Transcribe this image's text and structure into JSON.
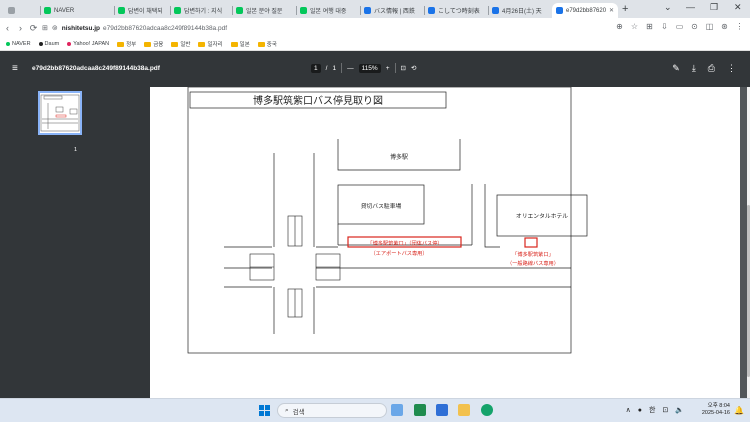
{
  "browser": {
    "tabs": [
      {
        "label": "",
        "color": "#9aa0a6"
      },
      {
        "label": "NAVER",
        "color": "#03c75a"
      },
      {
        "label": "답변이 채택되",
        "color": "#03c75a"
      },
      {
        "label": "답변하기 : 지식",
        "color": "#03c75a"
      },
      {
        "label": "일본 분야 질문",
        "color": "#03c75a"
      },
      {
        "label": "일본 여행 대중",
        "color": "#03c75a"
      },
      {
        "label": "バス情報 | 西鉄",
        "color": "#1a73e8"
      },
      {
        "label": "こしてつ時刻表",
        "color": "#1a73e8"
      },
      {
        "label": "4月26日(土) 天",
        "color": "#1a73e8"
      },
      {
        "label": "e79d2bb87620",
        "color": "#1a73e8"
      }
    ],
    "new_tab": "+",
    "window_controls": {
      "dropdown": "⌄",
      "minimize": "—",
      "restore": "❐",
      "close": "✕"
    },
    "nav": {
      "back": "‹",
      "forward": "›",
      "reload": "⟳",
      "tune": "⊞"
    },
    "address": {
      "site": "nishitetsu.jp",
      "path": "e79d2bb87620adcaa8c249f89144b38a.pdf"
    },
    "toolbar_icons": [
      "⊕",
      "☆",
      "⊞",
      "⇩",
      "▭",
      "⊙",
      "◫",
      "⊛",
      "⋮"
    ],
    "bookmarks": [
      {
        "label": "NAVER",
        "kind": "dot",
        "color": "#03c75a"
      },
      {
        "label": "Daum",
        "kind": "dot",
        "color": "#222222"
      },
      {
        "label": "Yahoo! JAPAN",
        "kind": "dot",
        "color": "#e0245e"
      },
      {
        "label": "정부",
        "kind": "folder"
      },
      {
        "label": "금융",
        "kind": "folder"
      },
      {
        "label": "일반",
        "kind": "folder"
      },
      {
        "label": "일자리",
        "kind": "folder"
      },
      {
        "label": "일본",
        "kind": "folder"
      },
      {
        "label": "중국",
        "kind": "folder"
      }
    ]
  },
  "pdf": {
    "menu_icon": "≡",
    "filename": "e79d2bb87620adcaa8c249f89144b38a.pdf",
    "current_page": "1",
    "page_separator": "/",
    "total_pages": "1",
    "zoom_out": "—",
    "zoom": "115%",
    "zoom_in": "+",
    "fit_icon": "⊡",
    "rotate_icon": "⟲",
    "right_icons": {
      "annotate": "✎",
      "download": "⤓",
      "print": "⎙",
      "more": "⋮"
    },
    "thumbnail_label": "1"
  },
  "map": {
    "title": "博多駅筑紫口バス停見取り図",
    "station": "博多駅",
    "parking": "貸切バス駐車場",
    "hotel": "オリエンタルホテル",
    "stop1_label": "「博多駅筑紫口」（団体バス停）",
    "stop1_sub": "（エアポートバス専用）",
    "stop2_label": "「博多駅筑紫口」",
    "stop2_sub": "（一般路線バス専用）",
    "accent": "#d9251d"
  },
  "taskbar": {
    "search_placeholder": "검색",
    "tray_icons": {
      "up": "∧",
      "record": "●",
      "ime": "한",
      "display": "⊡",
      "volume": "🔈"
    },
    "time": "오후 8:04",
    "date": "2025-04-16",
    "notification": "🔔"
  }
}
